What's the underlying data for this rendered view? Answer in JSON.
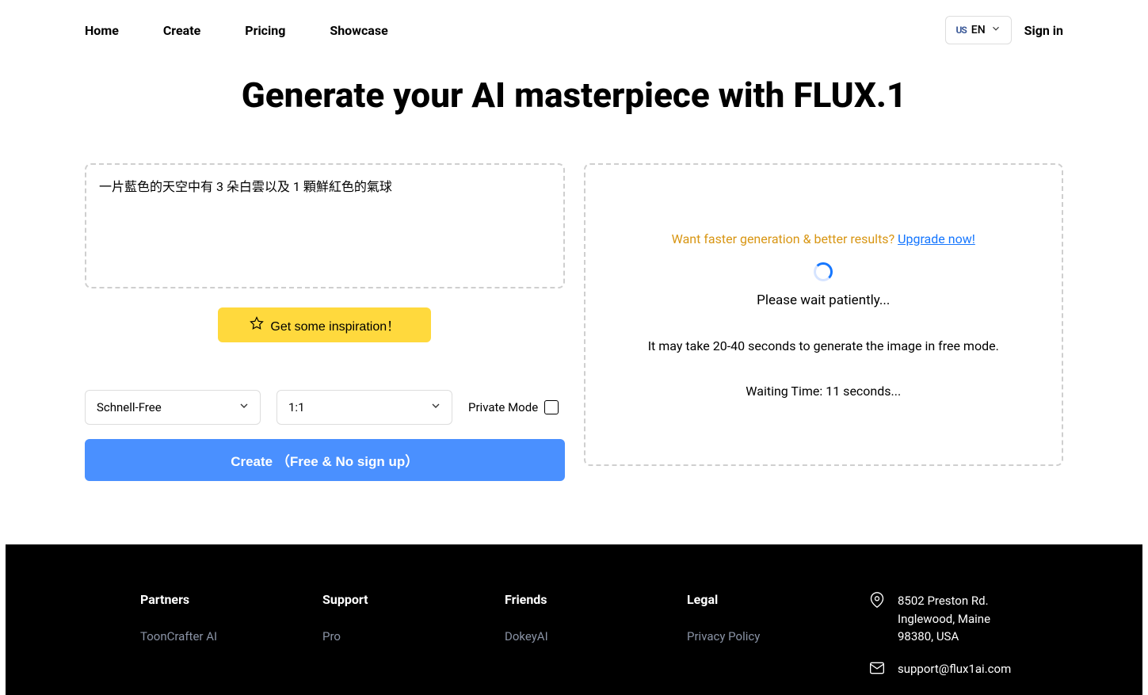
{
  "nav": {
    "home": "Home",
    "create": "Create",
    "pricing": "Pricing",
    "showcase": "Showcase"
  },
  "header": {
    "lang_flag": "US",
    "lang_code": "EN",
    "signin": "Sign in"
  },
  "hero": {
    "title": "Generate your AI masterpiece with FLUX.1"
  },
  "form": {
    "prompt_value": "一片藍色的天空中有 3 朵白雲以及 1 顆鮮紅色的氣球",
    "inspire_label": "Get some inspiration！",
    "model_selected": "Schnell-Free",
    "ratio_selected": "1:1",
    "private_label": "Private Mode",
    "create_label": "Create （Free & No sign up）"
  },
  "output": {
    "upgrade_prefix": "Want faster generation & better results? ",
    "upgrade_link": "Upgrade now!",
    "wait_text": "Please wait patiently...",
    "hint_text": "It may take 20-40 seconds to generate the image in free mode.",
    "waiting_time": "Waiting Time: 11 seconds..."
  },
  "footer": {
    "partners_title": "Partners",
    "partners_link1": "ToonCrafter AI",
    "support_title": "Support",
    "support_link1": "Pro",
    "friends_title": "Friends",
    "friends_link1": "DokeyAI",
    "legal_title": "Legal",
    "legal_link1": "Privacy Policy",
    "address": "8502 Preston Rd. Inglewood, Maine 98380, USA",
    "email": "support@flux1ai.com"
  }
}
